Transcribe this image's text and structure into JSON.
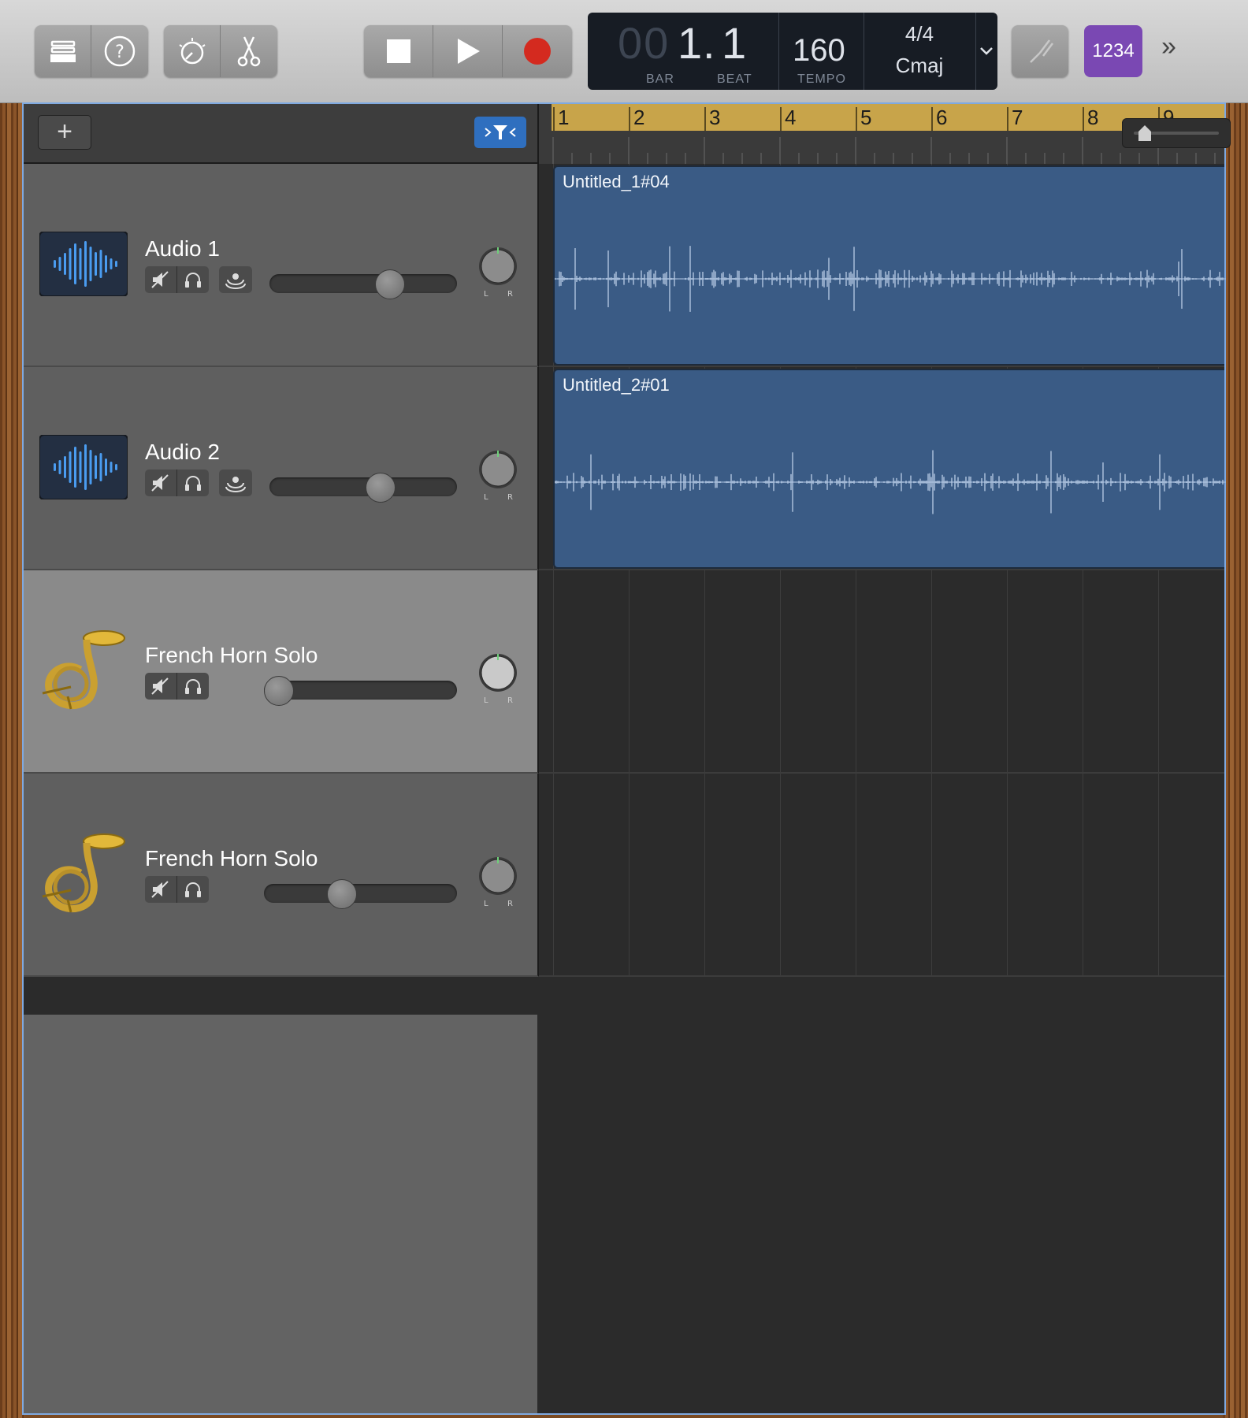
{
  "toolbar": {
    "lcd": {
      "bar_dim": "00",
      "bar_value": "1",
      "beat_value": "1",
      "bar_label": "BAR",
      "beat_label": "BEAT",
      "tempo_value": "160",
      "tempo_label": "TEMPO",
      "time_signature": "4/4",
      "key": "Cmaj"
    },
    "count_in_label": "1234",
    "more_label": "»"
  },
  "header": {
    "add_label": "+"
  },
  "ruler": {
    "bars": [
      "1",
      "2",
      "3",
      "4",
      "5",
      "6",
      "7",
      "8",
      "9"
    ]
  },
  "tracks": [
    {
      "name": "Audio 1",
      "type": "audio",
      "region": "Untitled_1#04",
      "volume": 0.64,
      "pan": 0.0
    },
    {
      "name": "Audio 2",
      "type": "audio",
      "region": "Untitled_2#01",
      "volume": 0.59,
      "pan": 0.0
    },
    {
      "name": "French Horn Solo",
      "type": "instrument",
      "region": "",
      "volume": 0.05,
      "pan": 0.0
    },
    {
      "name": "French Horn Solo",
      "type": "instrument",
      "region": "",
      "volume": 0.41,
      "pan": 0.0
    }
  ],
  "colors": {
    "record": "#d42a1f",
    "count_in": "#7a48b3",
    "region": "#3a5b85",
    "ruler": "#c8a44a"
  }
}
